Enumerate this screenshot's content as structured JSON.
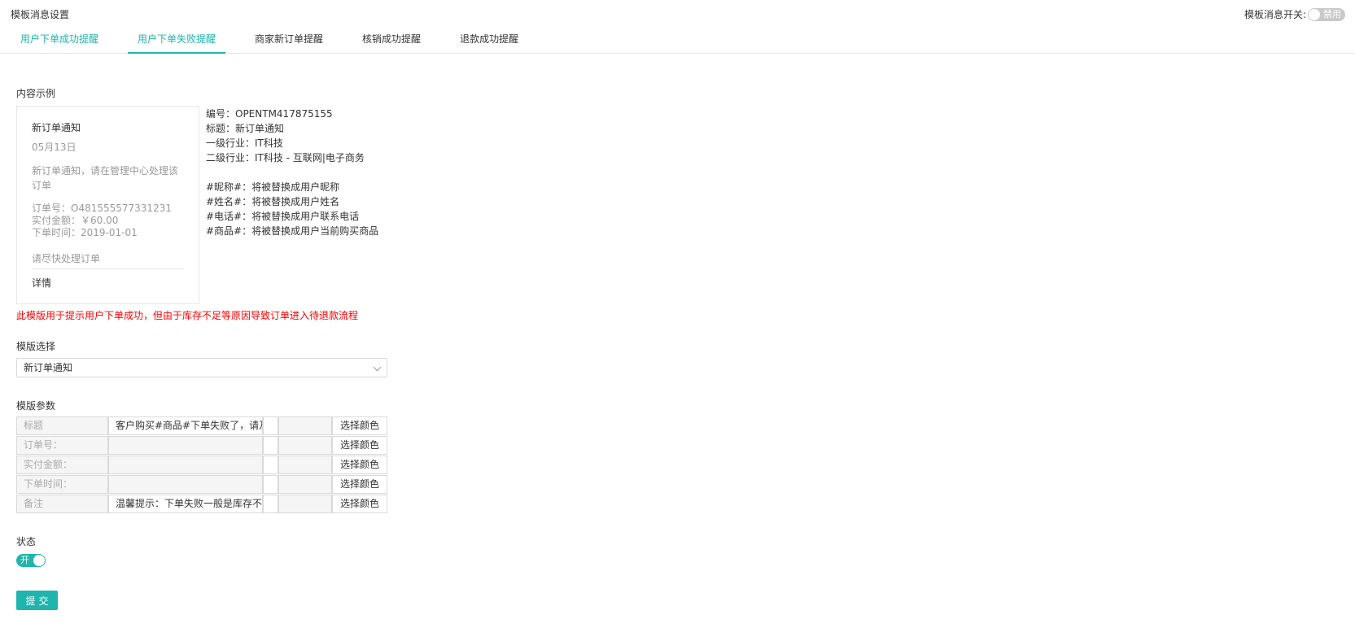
{
  "header": {
    "title": "模板消息设置",
    "switch_label": "模板消息开关:",
    "switch_state": "禁用"
  },
  "tabs": [
    {
      "label": "用户下单成功提醒"
    },
    {
      "label": "用户下单失败提醒"
    },
    {
      "label": "商家新订单提醒"
    },
    {
      "label": "核销成功提醒"
    },
    {
      "label": "退款成功提醒"
    }
  ],
  "sample": {
    "section_label": "内容示例",
    "card": {
      "title": "新订单通知",
      "date": "05月13日",
      "desc": "新订单通知，请在管理中心处理该订单",
      "order_no": "订单号：O481555577331231",
      "amount": "实付金额：￥60.00",
      "order_time": "下单时间：2019-01-01",
      "remark": "请尽快处理订单",
      "detail": "详情"
    },
    "info": {
      "code": "编号：OPENTM417875155",
      "title": "标题：新订单通知",
      "industry1": "一级行业：IT科技",
      "industry2": "二级行业：IT科技 - 互联网|电子商务",
      "var_nickname": "#昵称#：将被替换成用户昵称",
      "var_name": "#姓名#：将被替换成用户姓名",
      "var_phone": "#电话#：将被替换成用户联系电话",
      "var_goods": "#商品#：将被替换成用户当前购买商品"
    }
  },
  "warning": "此模版用于提示用户下单成功，但由于库存不足等原因导致订单进入待退款流程",
  "template_select": {
    "label": "模版选择",
    "value": "新订单通知"
  },
  "params": {
    "label": "模版参数",
    "pick_label": "选择颜色",
    "rows": [
      {
        "key": "标题",
        "value": "客户购买#商品#下单失败了，请及"
      },
      {
        "key": "订单号：",
        "value": ""
      },
      {
        "key": "实付金额：",
        "value": ""
      },
      {
        "key": "下单时间：",
        "value": ""
      },
      {
        "key": "备注",
        "value": "温馨提示：下单失败一般是库存不足"
      }
    ]
  },
  "status": {
    "label": "状态",
    "switch_state": "开"
  },
  "submit_label": "提交"
}
